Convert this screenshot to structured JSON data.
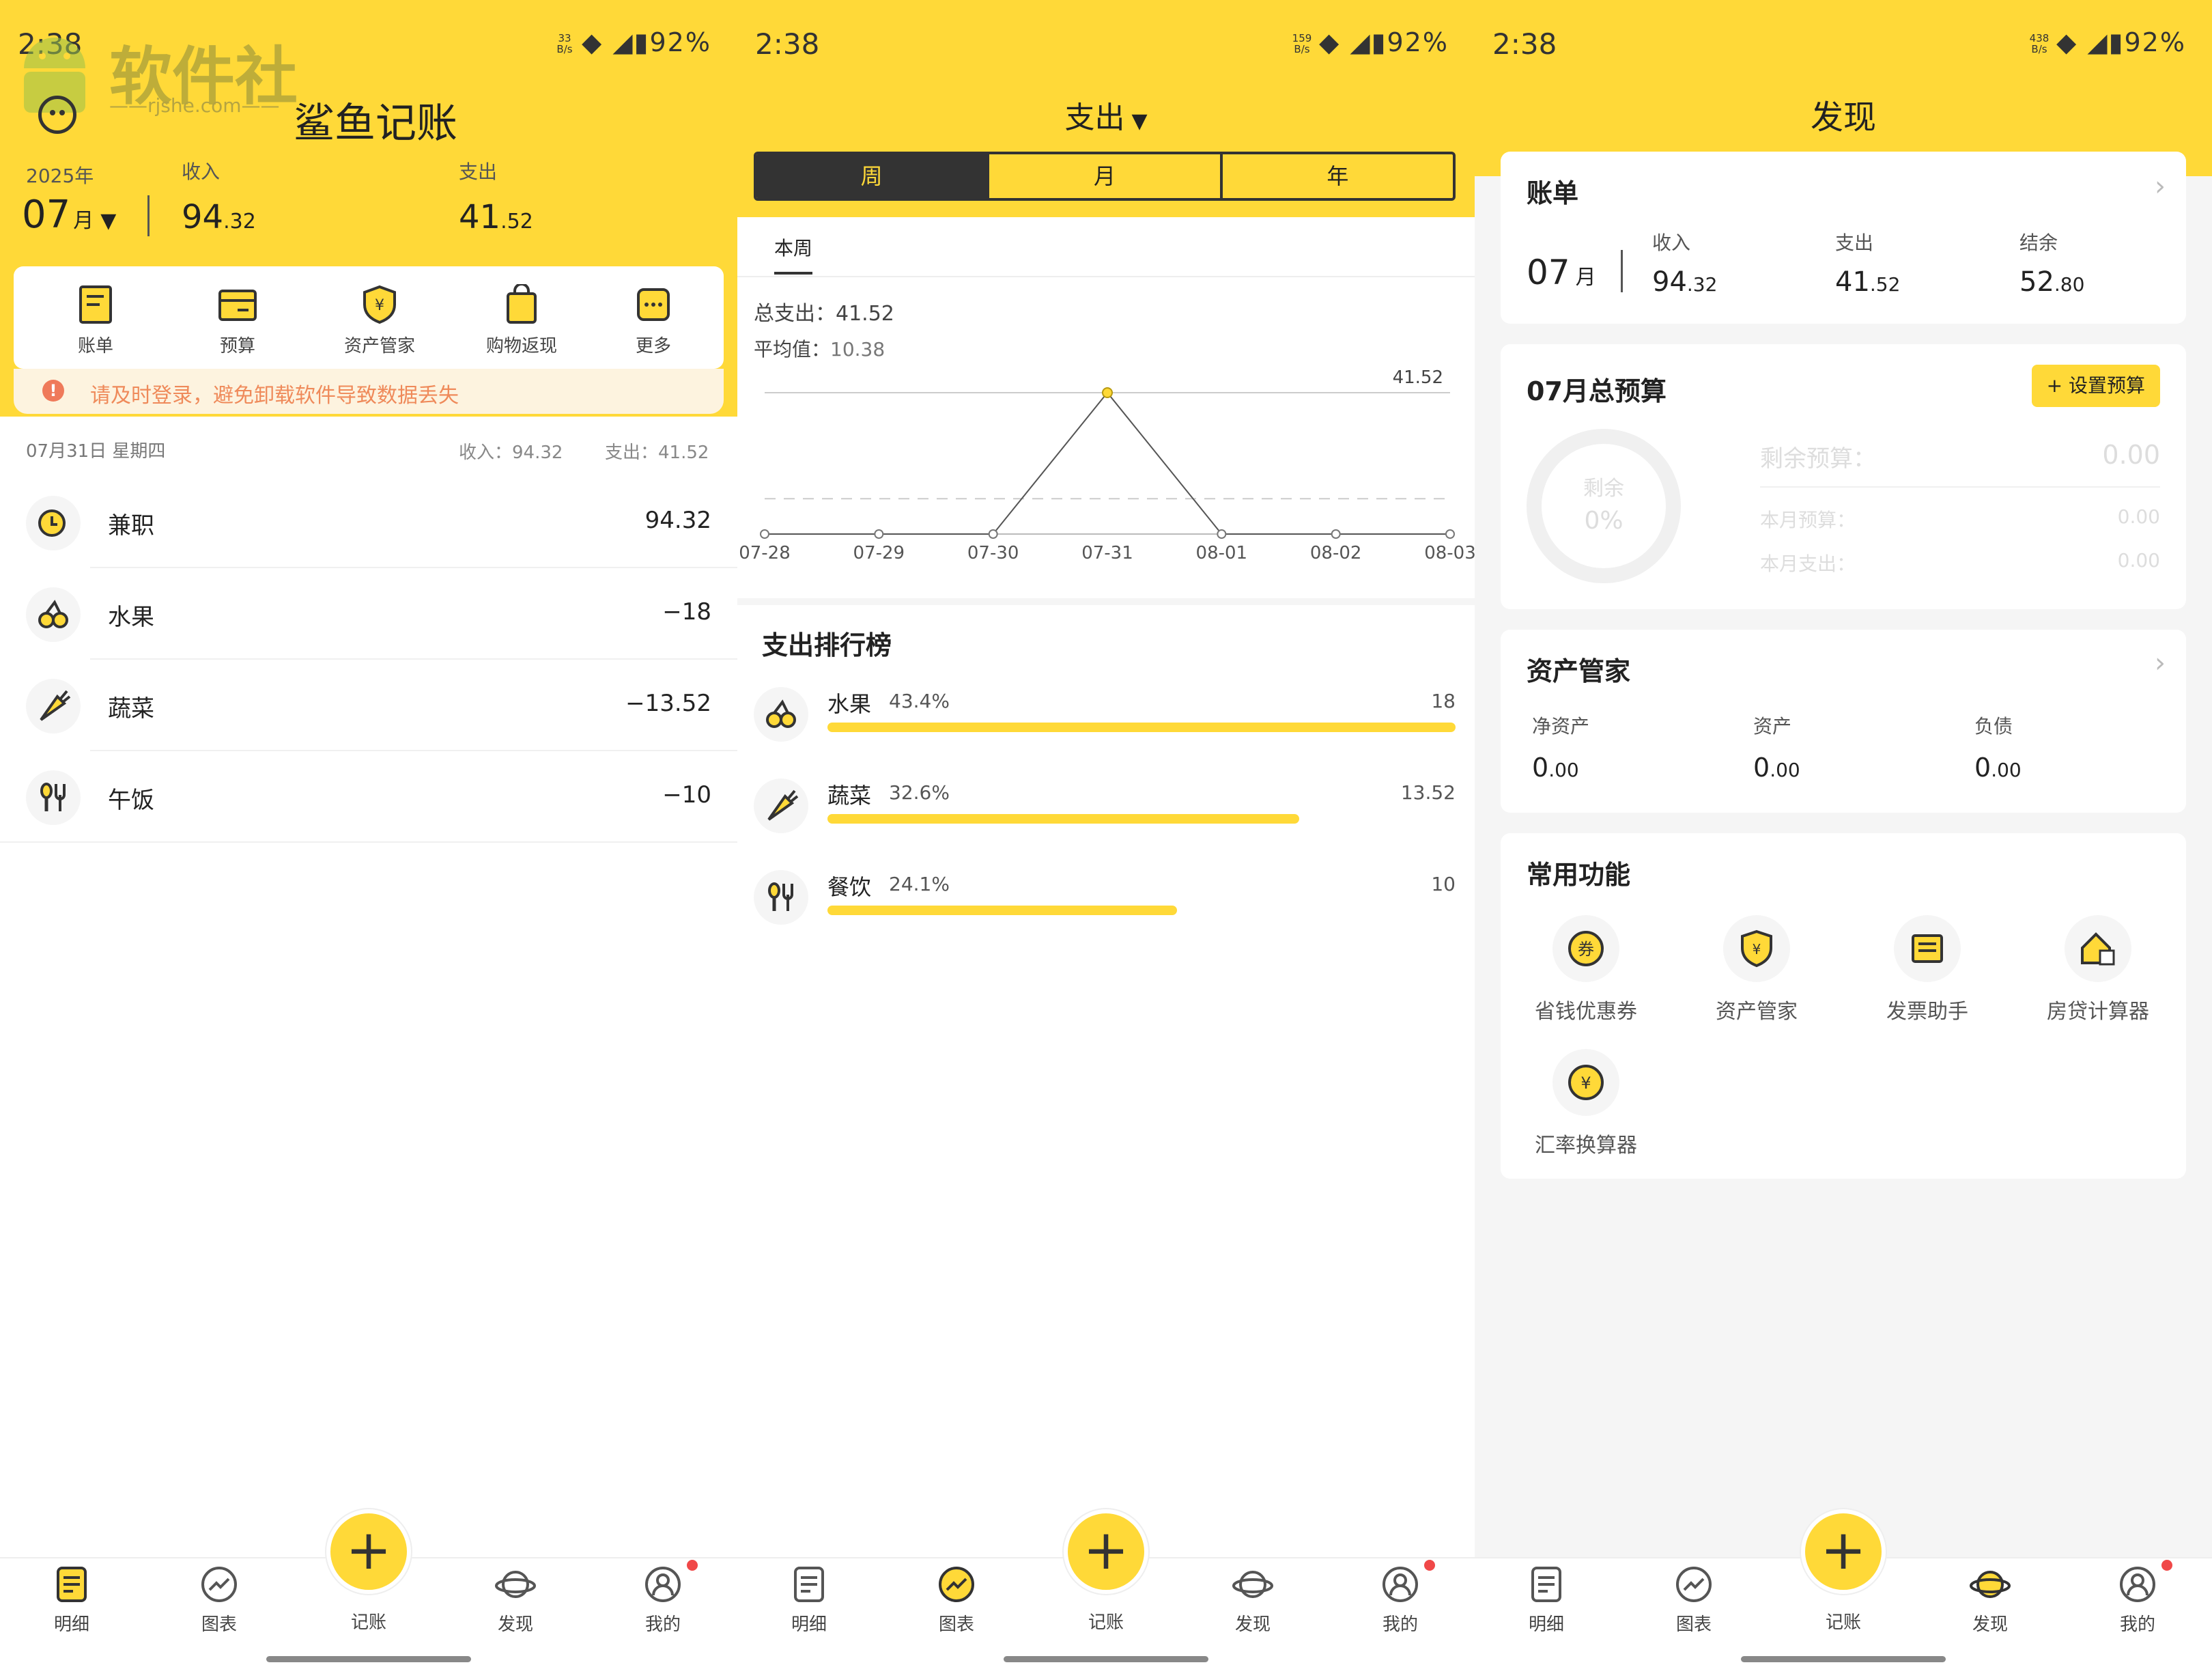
{
  "status": {
    "time": "2:38",
    "battery": "92%",
    "net_p1": "33\nB/s",
    "net_p2": "159\nB/s",
    "net_p3": "438\nB/s"
  },
  "watermark": {
    "name": "软件社",
    "url": "——rjshe.com——"
  },
  "detail": {
    "app_title": "鲨鱼记账",
    "year": "2025年",
    "month": "07",
    "month_unit": "月",
    "income_label": "收入",
    "income_int": "94",
    "income_dec": ".32",
    "expense_label": "支出",
    "expense_int": "41",
    "expense_dec": ".52",
    "quick": [
      "账单",
      "预算",
      "资产管家",
      "购物返现",
      "更多"
    ],
    "notice": "请及时登录，避免卸载软件导致数据丢失",
    "day_header": "07月31日 星期四",
    "day_income": "收入：94.32",
    "day_expense": "支出：41.52",
    "records": [
      {
        "name": "兼职",
        "amount": "94.32",
        "icon": "salary-icon"
      },
      {
        "name": "水果",
        "amount": "−18",
        "icon": "fruit-icon"
      },
      {
        "name": "蔬菜",
        "amount": "−13.52",
        "icon": "vegetable-icon"
      },
      {
        "name": "午饭",
        "amount": "−10",
        "icon": "meal-icon"
      }
    ]
  },
  "chart_page": {
    "title": "支出",
    "segments": [
      "周",
      "月",
      "年"
    ],
    "subtab": "本周",
    "total": "总支出：41.52",
    "avg_label": "平均值：",
    "avg_value": "10.38",
    "ranking_title": "支出排行榜",
    "ranking": [
      {
        "name": "水果",
        "pct": "43.4%",
        "value": "18",
        "share": 1.0
      },
      {
        "name": "蔬菜",
        "pct": "32.6%",
        "value": "13.52",
        "share": 0.751
      },
      {
        "name": "餐饮",
        "pct": "24.1%",
        "value": "10",
        "share": 0.556
      }
    ]
  },
  "chart_data": {
    "type": "line",
    "title": "",
    "categories": [
      "07-28",
      "07-29",
      "07-30",
      "07-31",
      "08-01",
      "08-02",
      "08-03"
    ],
    "series": [
      {
        "values": [
          0,
          0,
          0,
          41.52,
          0,
          0,
          0
        ]
      }
    ],
    "peak_label": "41.52",
    "average": 10.38,
    "ylim": [
      0,
      41.52
    ],
    "grid": false
  },
  "discover": {
    "title": "发现",
    "bill_title": "账单",
    "bill_month": "07",
    "bill_month_unit": "月",
    "bill_income_label": "收入",
    "bill_income_int": "94",
    "bill_income_dec": ".32",
    "bill_expense_label": "支出",
    "bill_expense_int": "41",
    "bill_expense_dec": ".52",
    "bill_balance_label": "结余",
    "bill_balance_int": "52",
    "bill_balance_dec": ".80",
    "budget_title": "07月总预算",
    "budget_button": "+ 设置预算",
    "budget_ring_label": "剩余",
    "budget_ring_pct": "0%",
    "budget_remaining_label": "剩余预算：",
    "budget_remaining_value": "0.00",
    "budget_month_label": "本月预算：",
    "budget_month_value": "0.00",
    "budget_spent_label": "本月支出：",
    "budget_spent_value": "0.00",
    "asset_title": "资产管家",
    "asset_net_label": "净资产",
    "asset_net_int": "0",
    "asset_net_dec": ".00",
    "asset_label": "资产",
    "asset_int": "0",
    "asset_dec": ".00",
    "debt_label": "负债",
    "debt_int": "0",
    "debt_dec": ".00",
    "tools_title": "常用功能",
    "tools": [
      "省钱优惠券",
      "资产管家",
      "发票助手",
      "房贷计算器",
      "汇率换算器"
    ]
  },
  "tabs": [
    "明细",
    "图表",
    "记账",
    "发现",
    "我的"
  ],
  "colors": {
    "accent": "#ffd938",
    "dark": "#333333",
    "red": "#f04848"
  }
}
